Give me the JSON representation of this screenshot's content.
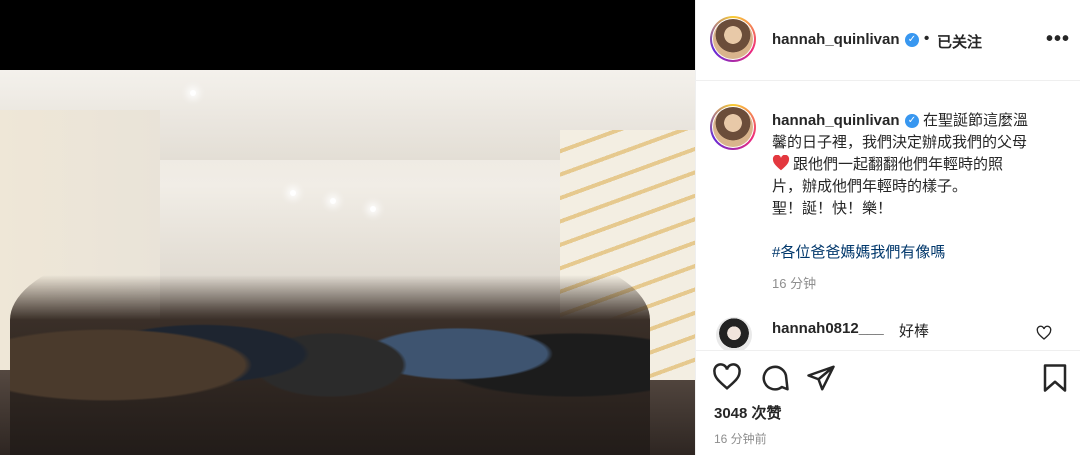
{
  "post": {
    "username": "hannah_quinlivan",
    "follow_label": "已关注",
    "separator": "•",
    "more_label": "•••",
    "caption_lines": [
      "在聖誕節這麼溫",
      "馨的日子裡，我們決定辦成我們的父母",
      "跟他們一起翻翻他們年輕時的照",
      "片，辦成他們年輕時的樣子。",
      "聖！誕！快！樂！"
    ],
    "hashtag": "#各位爸爸媽媽我們有像嗎",
    "caption_time": "16 分钟",
    "comment": {
      "username": "hannah0812___",
      "text": "好棒"
    },
    "likes": "3048 次赞",
    "date": "16 分钟前"
  },
  "colors": {
    "accent": "#3897f0",
    "hashtag": "#00376b",
    "heart": "#e3383f"
  },
  "icons": [
    "verified-icon",
    "more-icon",
    "heart-emoji-icon",
    "like-icon",
    "comment-icon",
    "share-icon",
    "save-icon",
    "comment-like-icon"
  ]
}
